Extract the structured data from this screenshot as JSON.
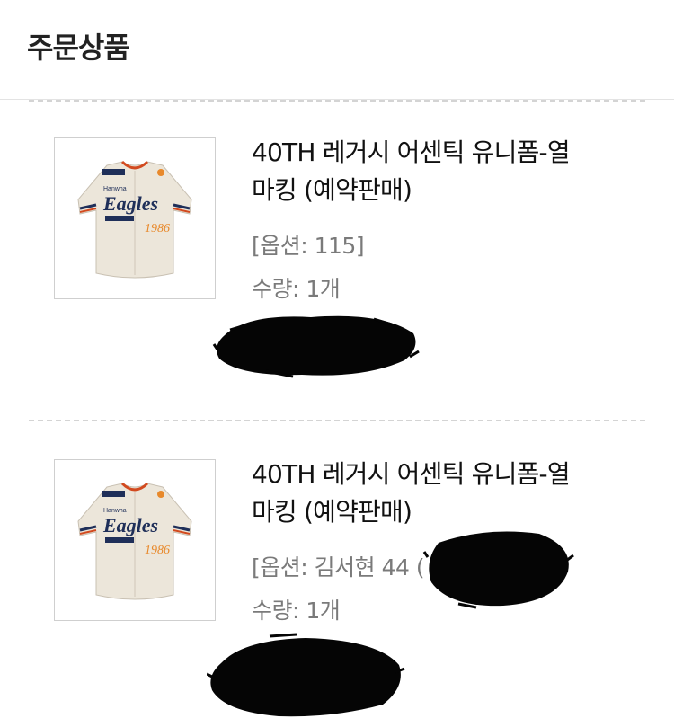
{
  "header": {
    "title": "주문상품"
  },
  "items": [
    {
      "name_line1": "40TH 레거시 어센틱 유니폼-열",
      "name_line2": "마킹 (예약판매)",
      "option": "[옵션: 115]",
      "quantity": "수량: 1개",
      "jersey_text": "Eagles"
    },
    {
      "name_line1": "40TH 레거시 어센틱 유니폼-열",
      "name_line2": "마킹 (예약판매)",
      "option": "[옵션: 김서현 44 (",
      "quantity": "수량: 1개",
      "jersey_text": "Eagles"
    }
  ]
}
